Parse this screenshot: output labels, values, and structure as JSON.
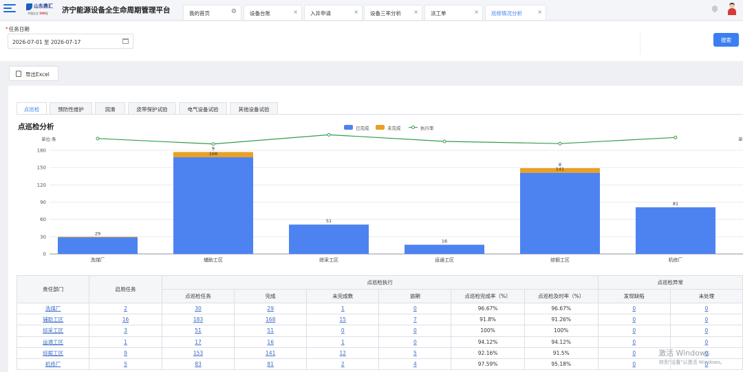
{
  "header": {
    "logo_text": "山东鼎汇",
    "logo_sub_a": "中国企业",
    "logo_sub_b": "500",
    "logo_sub_c": "强",
    "app_title": "济宁能源设备全生命周期管理平台",
    "tabs": [
      {
        "label": "我的首页",
        "icon": "gear-icon"
      },
      {
        "label": "设备台账",
        "icon": "close-icon"
      },
      {
        "label": "入井申请",
        "icon": "close-icon"
      },
      {
        "label": "设备三率分析",
        "icon": "close-icon"
      },
      {
        "label": "派工单",
        "icon": "close-icon"
      },
      {
        "label": "巡修情况分析",
        "icon": "close-icon",
        "active": true
      }
    ],
    "close_glyph": "×",
    "gear_glyph": "⚙"
  },
  "filter": {
    "required_mark": "*",
    "label": "任务日期",
    "date_range": "2026-07-01 至 2026-07-17",
    "search_label": "搜索"
  },
  "toolbar": {
    "export_label": "导出Excel"
  },
  "subtabs": [
    "点巡检",
    "预防性维护",
    "润滑",
    "皮带保护试验",
    "电气设备试验",
    "其他设备试验"
  ],
  "active_subtab": "点巡检",
  "chart_title": "点巡检分析",
  "unit_label": "单位:条",
  "unit_label_right": "单",
  "chart_data": {
    "type": "bar",
    "stacked": true,
    "categories": [
      "洗煤厂",
      "辅助工区",
      "综采工区",
      "运通工区",
      "综掘工区",
      "机修厂"
    ],
    "series": [
      {
        "name": "已完成",
        "color": "#4d83f1",
        "values": [
          29,
          168,
          51,
          16,
          141,
          81
        ]
      },
      {
        "name": "未完成",
        "color": "#eaa022",
        "values": [
          1,
          9,
          0,
          0,
          8,
          0
        ]
      },
      {
        "name": "执行率",
        "color": "#2e9e4a",
        "type": "line",
        "values": [
          96.67,
          91.8,
          100,
          94.12,
          92.16,
          97.59
        ]
      }
    ],
    "data_labels": [
      "29",
      "168",
      "51",
      "16",
      "141",
      "81"
    ],
    "top_labels": [
      "",
      "9",
      "",
      "",
      "8",
      ""
    ],
    "ylim": [
      0,
      180
    ],
    "yticks": [
      0,
      30,
      60,
      90,
      120,
      150,
      180
    ],
    "grid": true,
    "legend": "top-center"
  },
  "table": {
    "group_headers": [
      "责任部门",
      "启用任务",
      "点巡检执行",
      "点巡检异常"
    ],
    "columns": [
      "点巡检任务",
      "完成",
      "未完成数",
      "逾期",
      "点巡检完成率（%）",
      "点巡检及时率（%）",
      "发现缺陷",
      "未处理"
    ],
    "rows": [
      [
        "洗煤厂",
        "2",
        "30",
        "29",
        "1",
        "0",
        "96.67%",
        "96.67%",
        "0",
        "0"
      ],
      [
        "辅助工区",
        "16",
        "183",
        "168",
        "15",
        "7",
        "91.8%",
        "91.26%",
        "0",
        "0"
      ],
      [
        "综采工区",
        "3",
        "51",
        "51",
        "0",
        "0",
        "100%",
        "100%",
        "0",
        "0"
      ],
      [
        "运通工区",
        "1",
        "17",
        "16",
        "1",
        "0",
        "94.12%",
        "94.12%",
        "0",
        "0"
      ],
      [
        "综掘工区",
        "9",
        "153",
        "141",
        "12",
        "5",
        "92.16%",
        "91.5%",
        "0",
        "0"
      ],
      [
        "机修厂",
        "5",
        "83",
        "81",
        "2",
        "4",
        "97.59%",
        "95.18%",
        "0",
        "0"
      ]
    ]
  },
  "watermark": {
    "line1": "激活 Windows",
    "line2": "转到\"设置\"以激活 Windows。"
  }
}
